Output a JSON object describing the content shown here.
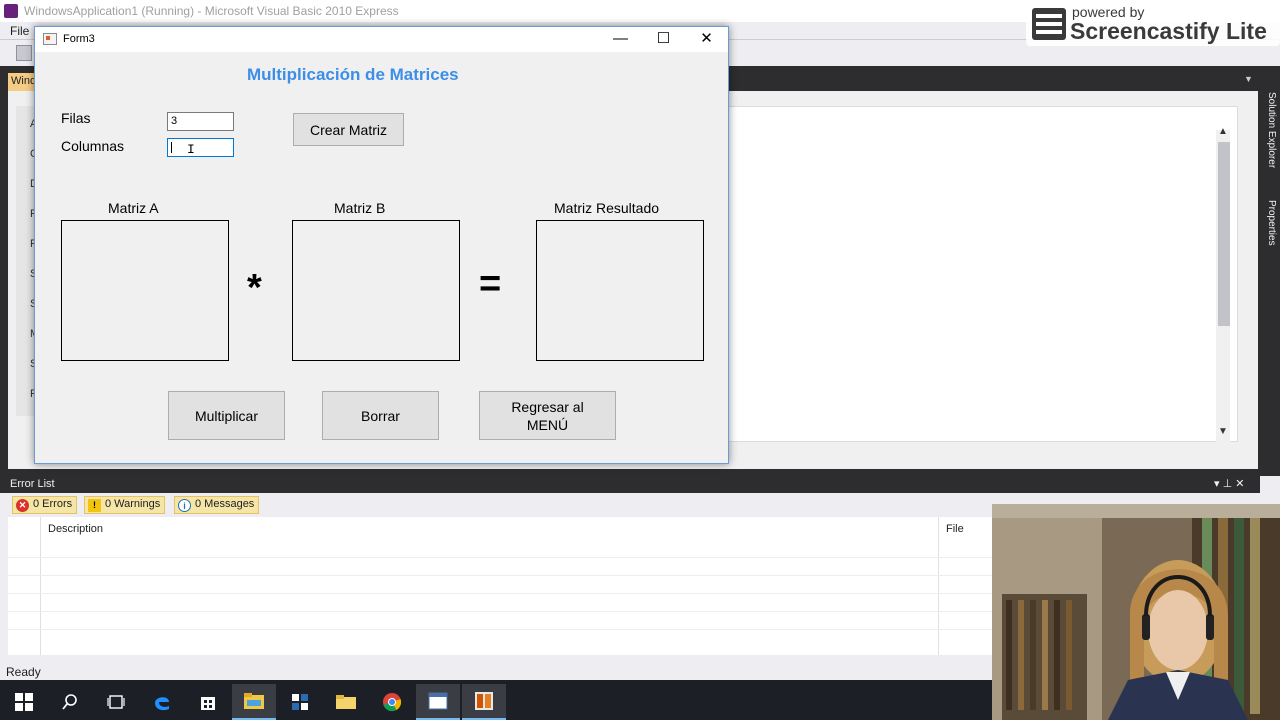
{
  "vs": {
    "title": "WindowsApplication1 (Running) - Microsoft Visual Basic 2010 Express",
    "menu_file": "File",
    "doc_tab": "Windo",
    "toolbox_letters": [
      "A",
      "C",
      "D",
      "F",
      "F",
      "S",
      "S",
      "M",
      "S",
      "P"
    ],
    "side_labels": [
      "Solution Explorer",
      "Properties"
    ]
  },
  "form": {
    "title": "Form3",
    "heading": "Multiplicación de Matrices",
    "filas_label": "Filas",
    "columnas_label": "Columnas",
    "filas_value": "3",
    "columnas_value": "",
    "crear_button": "Crear Matriz",
    "matriz_a_label": "Matriz A",
    "matriz_b_label": "Matriz B",
    "matriz_resultado_label": "Matriz Resultado",
    "multiply_symbol": "*",
    "equals_symbol": "=",
    "multiplicar_button": "Multiplicar",
    "borrar_button": "Borrar",
    "regresar_button_line1": "Regresar al",
    "regresar_button_line2": "MENÚ"
  },
  "error_list": {
    "title": "Error List",
    "errors": "0 Errors",
    "warnings": "0 Warnings",
    "messages": "0 Messages",
    "col_description": "Description",
    "col_file": "File"
  },
  "status": {
    "text": "Ready"
  },
  "overlay": {
    "powered_by": "powered by",
    "brand": "Screencastify Lite"
  },
  "colors": {
    "heading_blue": "#3c8ee8",
    "vs_dark": "#2d2d30",
    "form_bg": "#f0f0f0",
    "filter_highlight": "#f5e6a8"
  }
}
